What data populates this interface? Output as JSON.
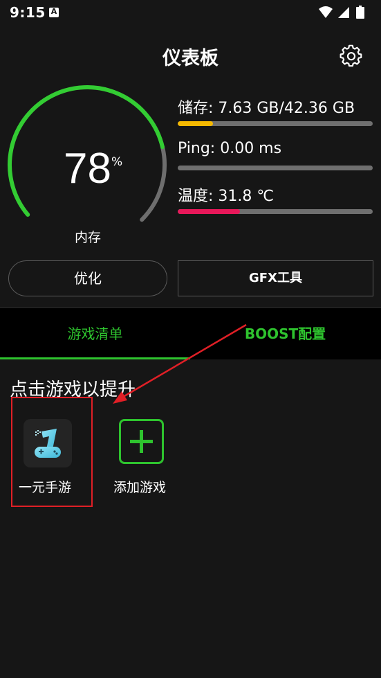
{
  "status_bar": {
    "time": "9:15",
    "notification_icon_letter": "A"
  },
  "header": {
    "title": "仪表板"
  },
  "gauge": {
    "value": "78",
    "unit": "%",
    "label": "内存",
    "percent": 78,
    "color": "#33cc33"
  },
  "stats": {
    "storage": {
      "label": "储存: 7.63 GB/42.36 GB",
      "fill_percent": 18,
      "color": "#f5b800"
    },
    "ping": {
      "label": "Ping: 0.00 ms",
      "fill_percent": 0,
      "color": "#2ec32e"
    },
    "temperature": {
      "label": "温度: 31.8 ℃",
      "fill_percent": 32,
      "color": "#e8185a"
    }
  },
  "buttons": {
    "optimize": "优化",
    "gfx": "GFX工具"
  },
  "tabs": [
    {
      "label": "游戏清单",
      "active": true
    },
    {
      "label": "BOOST配置",
      "active": false
    }
  ],
  "section": {
    "title": "点击游戏以提升"
  },
  "games": [
    {
      "name": "一元手游"
    }
  ],
  "add_game": {
    "label": "添加游戏"
  },
  "colors": {
    "accent": "#2ec32e",
    "background": "#161616",
    "annotation": "#e01f26"
  }
}
